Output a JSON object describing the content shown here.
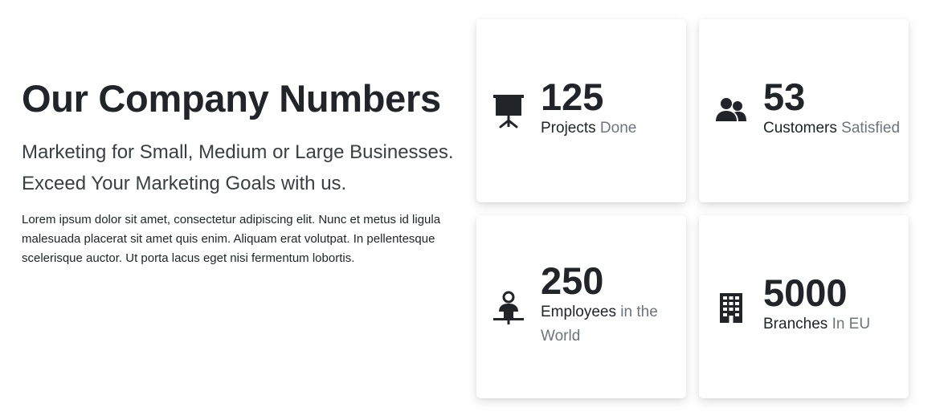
{
  "hero": {
    "title": "Our Company Numbers",
    "subtitle_line1": "Marketing for Small, Medium or Large Businesses.",
    "subtitle_line2": "Exceed Your Marketing Goals with us.",
    "body": "Lorem ipsum dolor sit amet, consectetur adipiscing elit. Nunc et metus id ligula malesuada placerat sit amet quis enim. Aliquam erat volutpat. In pellentesque scelerisque auctor. Ut porta lacus eget nisi fermentum lobortis."
  },
  "stats": [
    {
      "icon": "presentation-icon",
      "number": "125",
      "label": "Projects",
      "sublabel": "Done"
    },
    {
      "icon": "users-icon",
      "number": "53",
      "label": "Customers",
      "sublabel": "Satisfied"
    },
    {
      "icon": "employee-desk-icon",
      "number": "250",
      "label": "Employees",
      "sublabel": "in the World"
    },
    {
      "icon": "building-icon",
      "number": "5000",
      "label": "Branches",
      "sublabel": "In EU"
    }
  ]
}
